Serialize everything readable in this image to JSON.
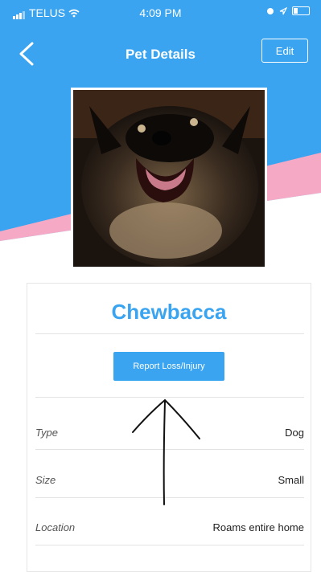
{
  "status_bar": {
    "carrier": "TELUS",
    "time": "4:09 PM"
  },
  "header": {
    "title": "Pet Details",
    "edit_label": "Edit",
    "color": "#3aa4f0",
    "accent_pink": "#f6a9c4"
  },
  "pet": {
    "name": "Chewbacca",
    "report_label": "Report Loss/Injury",
    "details": [
      {
        "label": "Type",
        "value": "Dog"
      },
      {
        "label": "Size",
        "value": "Small"
      },
      {
        "label": "Location",
        "value": "Roams entire home"
      }
    ]
  },
  "icons": [
    "signal-icon",
    "wifi-icon",
    "alarm-icon",
    "location-icon",
    "battery-icon",
    "back-icon",
    "arrow-annotation"
  ]
}
